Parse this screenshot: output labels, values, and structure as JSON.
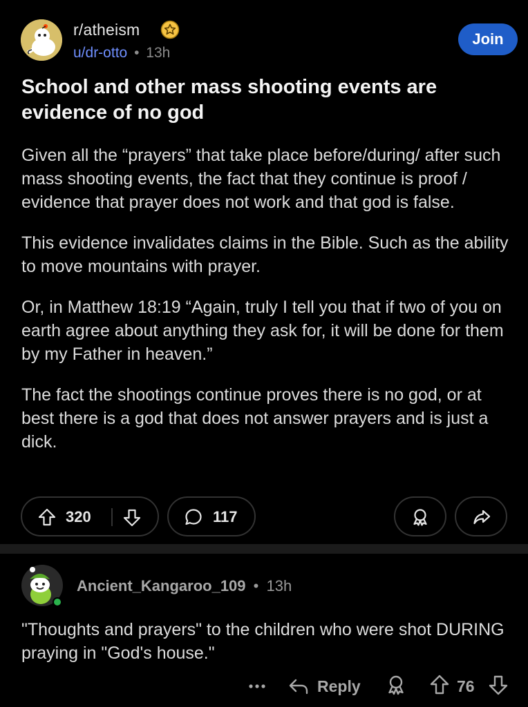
{
  "post": {
    "subreddit": "r/atheism",
    "author": "u/dr-otto",
    "separator": "•",
    "time": "13h",
    "join_label": "Join",
    "title": "School and other mass shooting events are evidence of no god",
    "paragraphs": [
      "Given all the “prayers” that take place before/during/ after such mass shooting events, the fact that they continue is proof / evidence that prayer does not work and that god is false.",
      "This evidence invalidates claims in the Bible. Such as the ability to move mountains with prayer.",
      "Or, in Matthew 18:19 “Again, truly I tell you that if two of you on earth agree about anything they ask for, it will be done for them by my Father in heaven.”",
      "The fact the shootings continue proves there is no god, or at best there is a god that does not answer prayers and is just a dick."
    ],
    "score": "320",
    "comment_count": "117"
  },
  "comment": {
    "author": "Ancient_Kangaroo_109",
    "separator": "•",
    "time": "13h",
    "text": "\"Thoughts and prayers\" to the children who were shot DURING praying in \"God's house.\"",
    "reply_label": "Reply",
    "score": "76",
    "online": true
  },
  "icons": {
    "subreddit_avatar": "reddit-snoo-ghost-avatar-icon",
    "badge": "star-badge-icon",
    "upvote": "arrow-up-outline-icon",
    "downvote": "arrow-down-outline-icon",
    "comment": "speech-bubble-icon",
    "award": "award-ribbon-icon",
    "share": "share-arrow-icon",
    "more": "ellipsis-icon",
    "reply": "reply-arrow-icon"
  },
  "colors": {
    "background": "#000000",
    "join_button": "#1f5dc8",
    "author_link": "#6f8fff",
    "text": "#dcdcdc",
    "muted": "#8c8c8c",
    "pill_border": "#333333",
    "online_dot": "#2bb24c"
  }
}
